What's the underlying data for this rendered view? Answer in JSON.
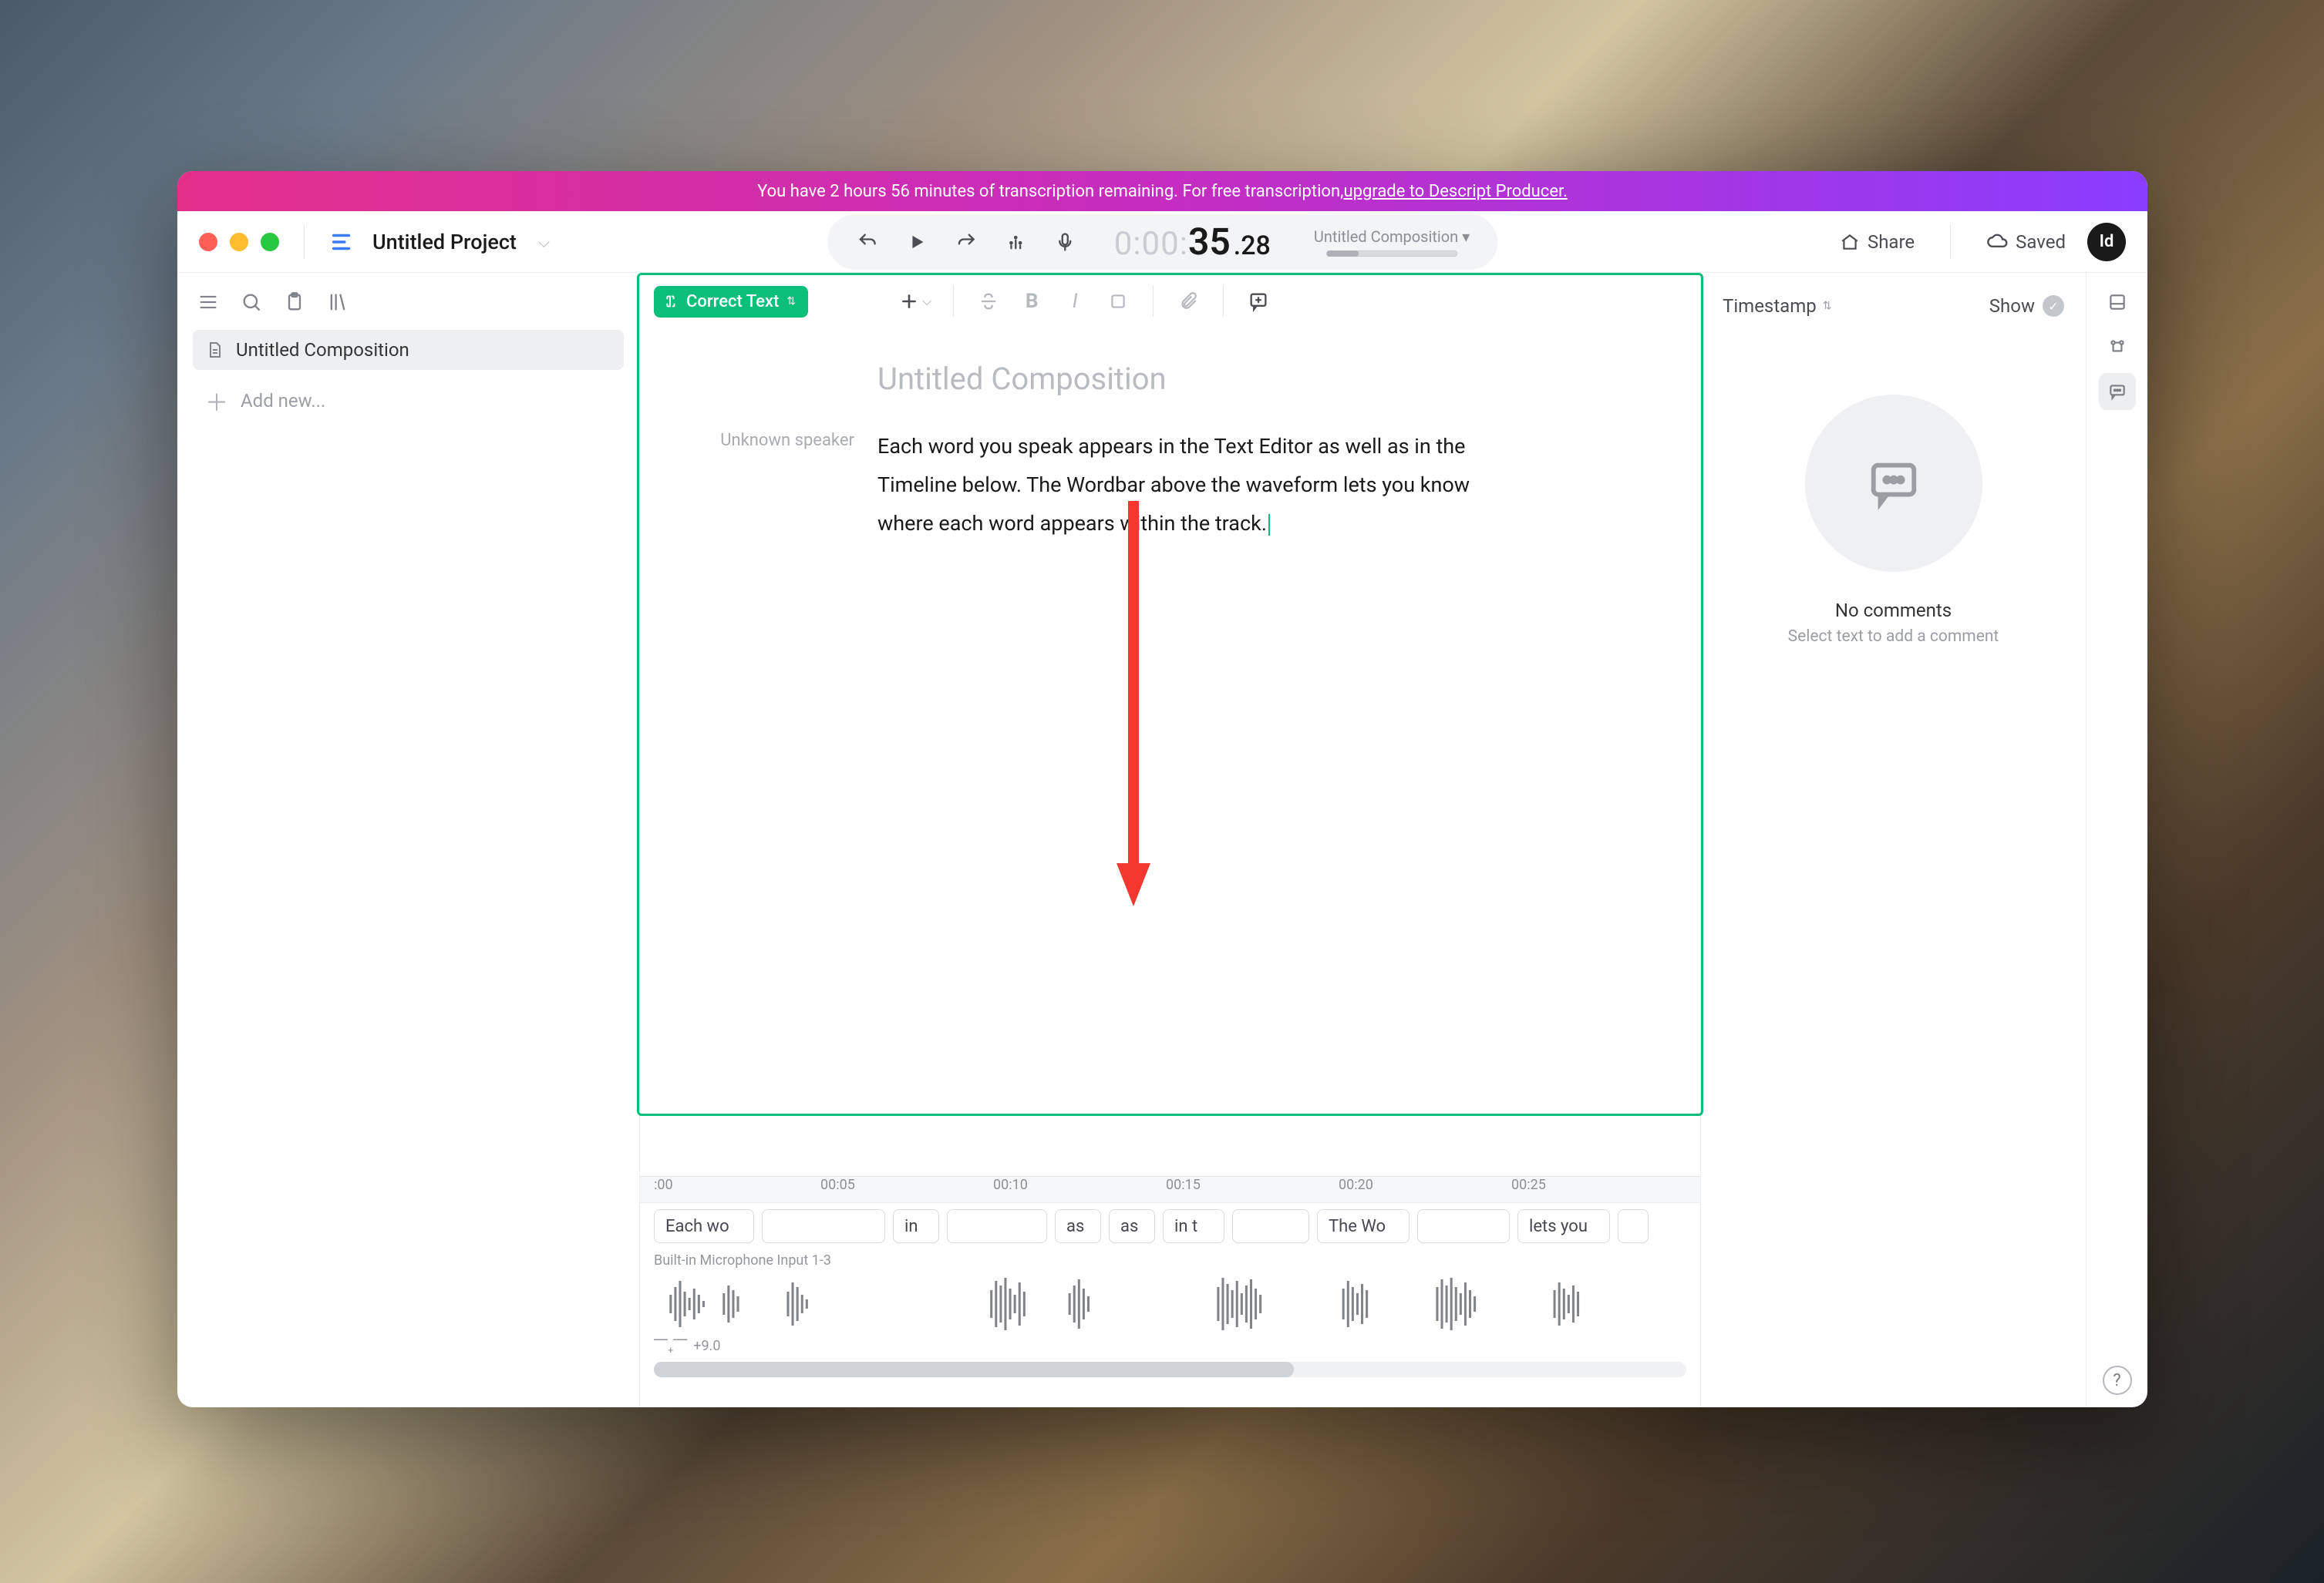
{
  "banner": {
    "text_prefix": "You have 2 hours 56 minutes of transcription remaining. For free transcription, ",
    "link_text": "upgrade to Descript Producer."
  },
  "project": {
    "name": "Untitled Project"
  },
  "transport": {
    "timecode_dim": "0:00:",
    "timecode_sec": "35",
    "timecode_frac": ".28",
    "composition_label": "Untitled Composition"
  },
  "header": {
    "share": "Share",
    "saved": "Saved",
    "avatar": "Id"
  },
  "sidebar": {
    "items": [
      {
        "label": "Untitled Composition"
      }
    ],
    "add_label": "Add new..."
  },
  "editor": {
    "mode_label": "Correct Text",
    "doc_title": "Untitled Composition",
    "speaker": "Unknown speaker",
    "paragraph": "Each word you speak appears in the Text Editor as well as in the Timeline below. The Wordbar above the waveform lets you know where each word appears within the track."
  },
  "comments": {
    "left_label": "Timestamp",
    "show_label": "Show",
    "empty_title": "No comments",
    "empty_sub": "Select text to add a comment"
  },
  "timeline": {
    "ticks": [
      ":00",
      "00:05",
      "00:10",
      "00:15",
      "00:20",
      "00:25"
    ],
    "word_chips": [
      "Each wo",
      "in",
      "as",
      "as",
      "in t",
      "The Wo",
      "lets you"
    ],
    "track_name": "Built-in Microphone Input 1-3",
    "db_label": "+9.0"
  }
}
